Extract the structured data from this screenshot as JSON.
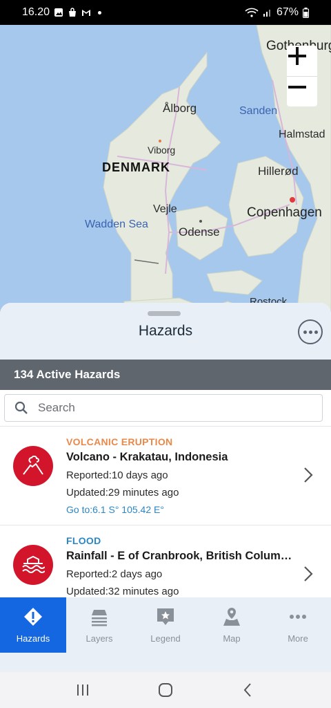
{
  "status_bar": {
    "time": "16.20",
    "battery": "67%"
  },
  "map": {
    "labels": {
      "gothenburg": "Gothenburg",
      "aalborg": "Ålborg",
      "sanden": "Sanden",
      "halmstad": "Halmstad",
      "viborg": "Viborg",
      "denmark": "DENMARK",
      "hillerod": "Hillerød",
      "vejle": "Vejle",
      "copenhagen": "Copenhagen",
      "wadden_sea": "Wadden Sea",
      "odense": "Odense",
      "rostock": "Rostock"
    },
    "zoom_in_icon": "plus-icon",
    "zoom_out_icon": "minus-icon"
  },
  "sheet": {
    "title": "Hazards",
    "active_count": "134 Active Hazards",
    "search_placeholder": "Search"
  },
  "hazards": [
    {
      "type": "VOLCANIC ERUPTION",
      "type_color": "#e8894a",
      "name": "Volcano - Krakatau, Indonesia",
      "reported": "Reported:10 days ago",
      "updated": "Updated:29 minutes ago",
      "goto": "Go to:6.1 S° 105.42 E°",
      "icon": "volcano-icon"
    },
    {
      "type": "FLOOD",
      "type_color": "#2b86c5",
      "name": "Rainfall - E of Cranbrook, British Columbia",
      "reported": "Reported:2 days ago",
      "updated": "Updated:32 minutes ago",
      "icon": "flood-icon"
    }
  ],
  "nav": {
    "hazards": "Hazards",
    "layers": "Layers",
    "legend": "Legend",
    "map": "Map",
    "more": "More"
  },
  "colors": {
    "accent": "#1467e0",
    "hazard_red": "#d3152c",
    "count_bar": "#5f666d"
  }
}
